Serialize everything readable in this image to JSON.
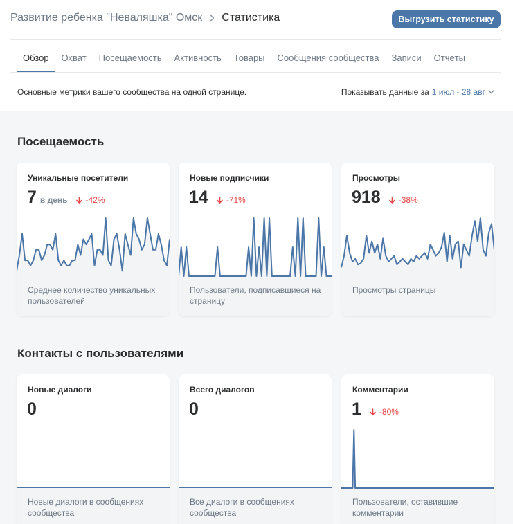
{
  "header": {
    "community": "Развитие ребенка \"Неваляшка\" Омск",
    "page": "Статистика",
    "export_label": "Выгрузить статистику"
  },
  "tabs": [
    {
      "label": "Обзор",
      "active": true
    },
    {
      "label": "Охват"
    },
    {
      "label": "Посещаемость"
    },
    {
      "label": "Активность"
    },
    {
      "label": "Товары"
    },
    {
      "label": "Сообщения сообщества"
    },
    {
      "label": "Записи"
    },
    {
      "label": "Отчёты"
    }
  ],
  "summary": {
    "description": "Основные метрики вашего сообщества на одной странице.",
    "period_label": "Показывать данные за",
    "period_range": "1 июл - 28 авг"
  },
  "colors": {
    "accent": "#4a76a8",
    "negative": "#e64646",
    "line": "#4a76a8"
  },
  "sections": {
    "attendance": {
      "title": "Посещаемость",
      "cards": [
        {
          "title": "Уникальные посетители",
          "value": "7",
          "unit": "в день",
          "delta": "-42%",
          "footer": "Среднее количество уникальных пользователей",
          "chart_data": {
            "type": "line",
            "values": [
              1,
              4,
              8,
              3,
              3,
              2,
              3,
              5,
              5,
              3,
              4,
              6,
              6,
              5,
              8,
              3,
              2,
              3,
              2,
              2,
              3,
              3,
              6,
              4,
              7,
              6,
              7,
              8,
              2,
              5,
              5,
              4,
              11,
              3,
              2,
              7,
              8,
              5,
              1,
              8,
              6,
              4,
              11,
              8,
              7,
              5,
              6,
              11,
              8,
              5,
              5,
              8,
              6,
              3,
              2,
              7
            ]
          }
        },
        {
          "title": "Новые подписчики",
          "value": "14",
          "unit": "",
          "delta": "-71%",
          "footer": "Пользователи, подписавшиеся на страницу",
          "chart_data": {
            "type": "line",
            "values": [
              0,
              1,
              0,
              1,
              0,
              0,
              0,
              0,
              0,
              0,
              0,
              0,
              0,
              0,
              0,
              1,
              0,
              0,
              0,
              0,
              0,
              0,
              0,
              0,
              0,
              0,
              0,
              1,
              0,
              2,
              0,
              1,
              0,
              2,
              0,
              2,
              0,
              0,
              0,
              0,
              0,
              0,
              0,
              0,
              1,
              0,
              2,
              0,
              2,
              0,
              0,
              0,
              0,
              0,
              2,
              0,
              1,
              0,
              0,
              0
            ]
          }
        },
        {
          "title": "Просмотры",
          "value": "918",
          "unit": "",
          "delta": "-38%",
          "footer": "Просмотры страницы",
          "chart_data": {
            "type": "line",
            "values": [
              6,
              14,
              28,
              16,
              10,
              12,
              8,
              9,
              12,
              28,
              16,
              24,
              16,
              22,
              12,
              26,
              14,
              10,
              12,
              14,
              8,
              10,
              12,
              10,
              8,
              12,
              10,
              14,
              12,
              14,
              16,
              12,
              22,
              18,
              14,
              16,
              20,
              30,
              10,
              28,
              12,
              22,
              24,
              6,
              22,
              18,
              14,
              28,
              38,
              24,
              40,
              18,
              14,
              30,
              36,
              18
            ]
          }
        }
      ]
    },
    "contacts": {
      "title": "Контакты с пользователями",
      "cards": [
        {
          "title": "Новые диалоги",
          "value": "0",
          "unit": "",
          "delta": "",
          "footer": "Новые диалоги в сообщениях сообщества",
          "chart_data": {
            "type": "line",
            "values": [
              0,
              0
            ]
          }
        },
        {
          "title": "Всего диалогов",
          "value": "0",
          "unit": "",
          "delta": "",
          "footer": "Все диалоги в сообщениях сообщества",
          "chart_data": {
            "type": "line",
            "values": [
              0,
              0
            ]
          }
        },
        {
          "title": "Комментарии",
          "value": "1",
          "unit": "",
          "delta": "-80%",
          "footer": "Пользователи, оставившие комментарии",
          "chart_data": {
            "type": "line",
            "values": [
              0,
              0,
              0,
              0,
              0,
              0,
              0,
              0,
              0,
              0,
              1,
              0,
              0,
              0,
              0,
              0,
              0,
              0,
              0,
              0,
              0,
              0,
              0,
              0,
              0,
              0,
              0,
              0,
              0,
              0,
              0,
              0,
              0,
              0,
              0,
              0,
              0,
              0,
              0,
              0,
              0,
              0,
              0,
              0,
              0,
              0,
              0,
              0,
              0,
              0,
              0,
              0,
              0,
              0,
              0,
              0,
              0,
              0,
              0,
              0,
              0,
              0,
              0,
              0,
              0,
              0,
              0,
              0,
              0,
              0,
              0,
              0,
              0,
              0,
              0,
              0,
              0,
              0,
              0,
              0,
              0,
              0,
              0,
              0,
              0,
              0,
              0,
              0,
              0,
              0,
              0,
              0,
              0,
              0,
              0,
              0,
              0,
              0,
              0,
              0,
              0,
              0,
              0,
              0,
              0,
              0,
              0,
              0,
              0,
              0,
              0,
              0,
              0,
              0,
              0,
              0,
              0,
              0,
              0,
              0,
              0,
              0
            ]
          }
        }
      ]
    }
  }
}
